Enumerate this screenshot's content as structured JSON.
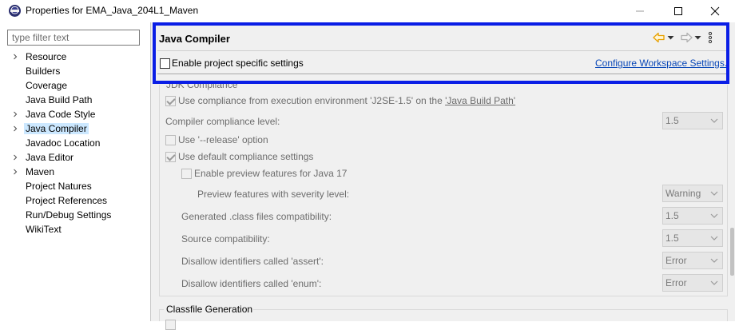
{
  "window": {
    "title": "Properties for EMA_Java_204L1_Maven",
    "minimize_icon": "minimize-icon",
    "maximize_icon": "maximize-icon",
    "close_icon": "close-icon"
  },
  "sidebar": {
    "filter_placeholder": "type filter text",
    "items": [
      {
        "label": "Resource",
        "expandable": true
      },
      {
        "label": "Builders",
        "expandable": false
      },
      {
        "label": "Coverage",
        "expandable": false
      },
      {
        "label": "Java Build Path",
        "expandable": false
      },
      {
        "label": "Java Code Style",
        "expandable": true
      },
      {
        "label": "Java Compiler",
        "expandable": true,
        "selected": true
      },
      {
        "label": "Javadoc Location",
        "expandable": false
      },
      {
        "label": "Java Editor",
        "expandable": true
      },
      {
        "label": "Maven",
        "expandable": true
      },
      {
        "label": "Project Natures",
        "expandable": false
      },
      {
        "label": "Project References",
        "expandable": false
      },
      {
        "label": "Run/Debug Settings",
        "expandable": false
      },
      {
        "label": "WikiText",
        "expandable": false
      }
    ]
  },
  "page": {
    "title": "Java Compiler",
    "enable_project_specific": {
      "label": "Enable project specific settings",
      "checked": false
    },
    "configure_link": "Configure Workspace Settings...",
    "jdk_group": "JDK Compliance",
    "use_compliance_prefix": "Use compliance from execution environment 'J2SE-1.5' on the ",
    "use_compliance_link": "'Java Build Path'",
    "compliance_level_label": "Compiler compliance level:",
    "compliance_level_value": "1.5",
    "release_option": "Use '--release' option",
    "default_compliance": "Use default compliance settings",
    "preview_features": "Enable preview features for Java 17",
    "preview_severity_label": "Preview features with severity level:",
    "preview_severity_value": "Warning",
    "class_compat_label": "Generated .class files compatibility:",
    "class_compat_value": "1.5",
    "source_compat_label": "Source compatibility:",
    "source_compat_value": "1.5",
    "assert_label": "Disallow identifiers called 'assert':",
    "assert_value": "Error",
    "enum_label": "Disallow identifiers called 'enum':",
    "enum_value": "Error",
    "classfile_group": "Classfile Generation"
  },
  "colors": {
    "highlight": "#0a1ee6",
    "selection": "#cce8ff",
    "link": "#0a48b8",
    "nav_arrow": "#e8a000"
  }
}
